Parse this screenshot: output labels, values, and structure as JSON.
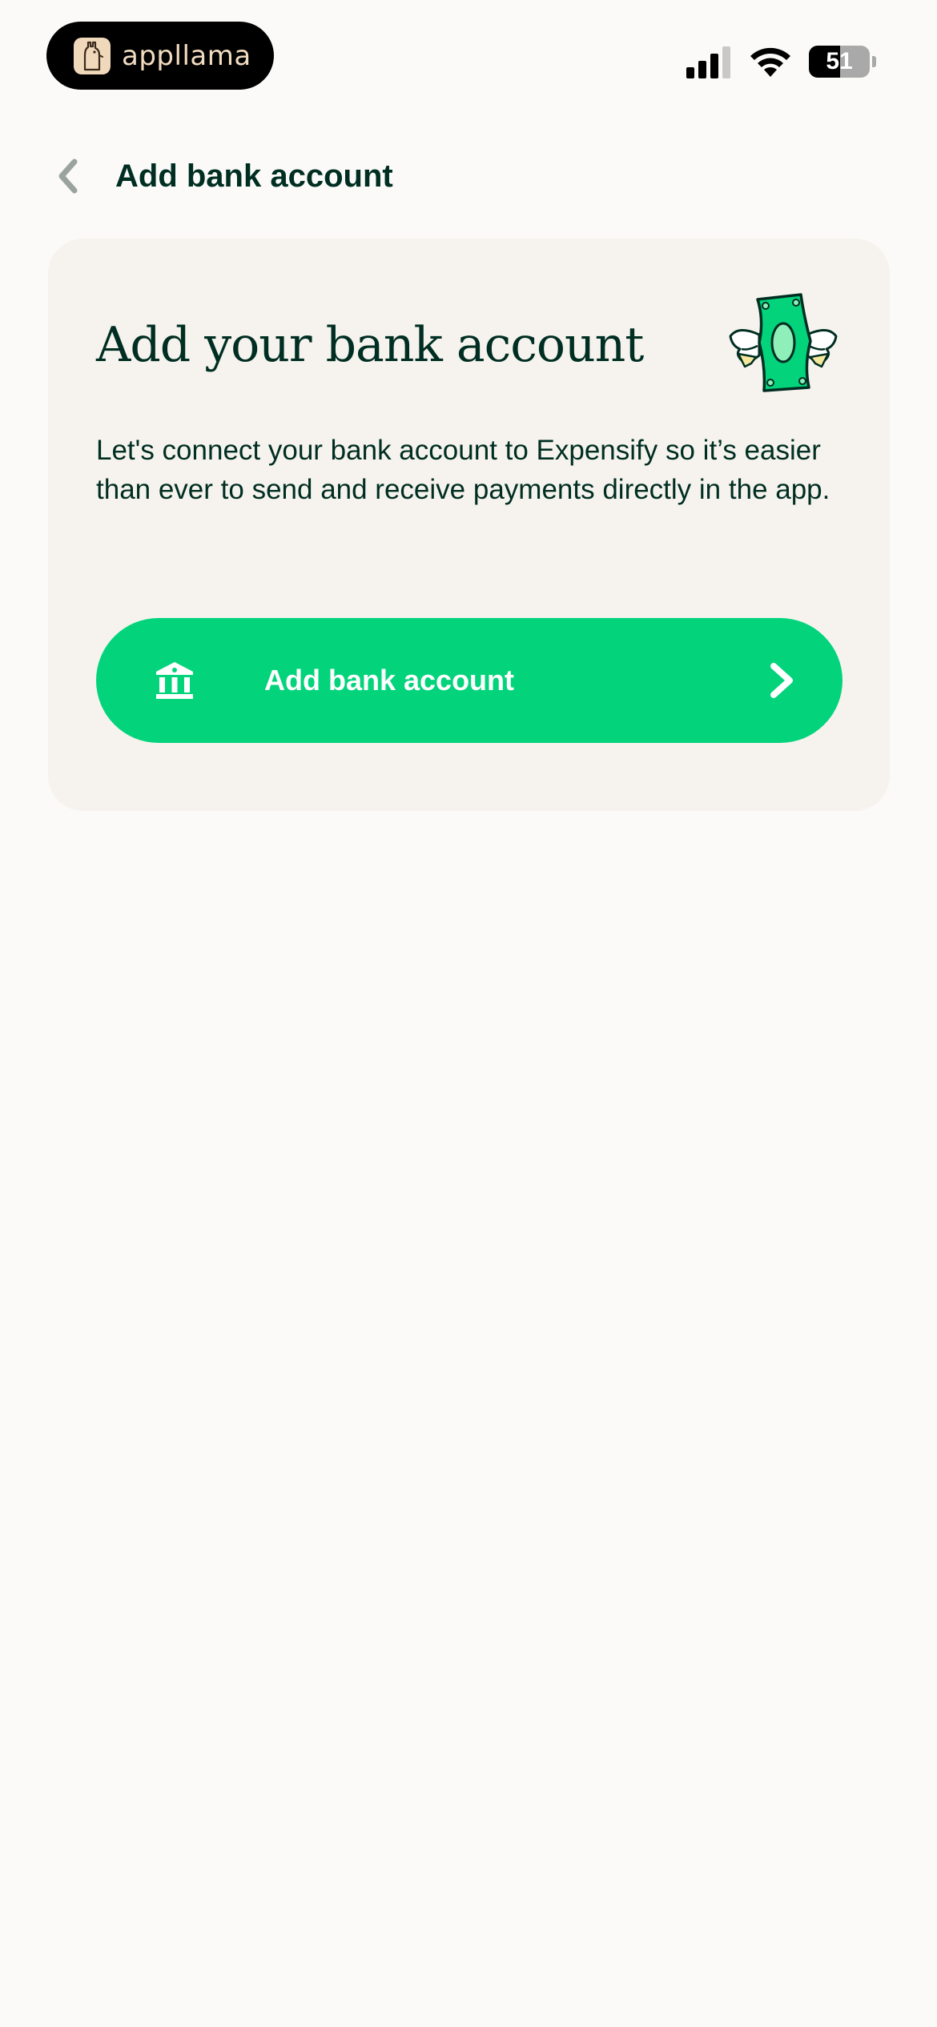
{
  "status_bar": {
    "brand_name": "appllama",
    "battery_level": "51",
    "battery_fraction": 0.51,
    "signal_bars_active": 3,
    "signal_bars_total": 4
  },
  "header": {
    "title": "Add bank account",
    "back_icon": "chevron-left-icon"
  },
  "card": {
    "title": "Add your bank account",
    "illustration": "flying-money-icon",
    "description": "Let's connect your bank account to Expensify so it’s easier than ever to send and receive payments directly in the app.",
    "button": {
      "label": "Add bank account",
      "icon": "bank-icon",
      "trailing_icon": "chevron-right-icon"
    }
  },
  "colors": {
    "background": "#FBFAF8",
    "card": "#F6F3EE",
    "text": "#002E22",
    "accent": "#03D47C"
  }
}
